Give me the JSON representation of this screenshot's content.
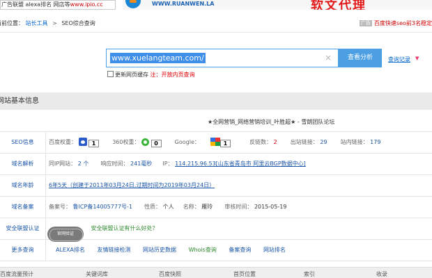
{
  "ads": {
    "left_part1": "广告联盟 alexa排名 网店等",
    "left_part2": "www.ipio.cc",
    "right_site": "WWW.RUANWEN.LA",
    "right_slogan": "软文代理"
  },
  "location": {
    "label": "当前位置：",
    "crumb1": "站长工具",
    "sep": ">",
    "crumb2": "SEO综合查询",
    "ad_tag": "广告",
    "ad_text": "百度快速seo前3名稳定"
  },
  "search": {
    "value": "www.xuelangteam.com/",
    "clear_icon": "×",
    "button": "查看分析",
    "history": "查询记录",
    "history_arrow": "▼",
    "cache_label": "更新网页缓存",
    "cache_note": "注：开放内页查询"
  },
  "section": {
    "title": "网站基本信息",
    "site_title": "★全网营销_网络营销培训_叶胜超★ - 雪朗团队论坛"
  },
  "rows": {
    "seo": {
      "label": "SEO信息",
      "baidu_label": "百度权重：",
      "baidu_val": "1",
      "q360_label": "360权重：",
      "q360_val": "0",
      "google_label": "Google：",
      "google_val": "1",
      "backlinks_label": "反链数：",
      "backlinks_val": "2",
      "outlinks_label": "出站链接：",
      "outlinks_val": "29",
      "inlinks_label": "站内链接：",
      "inlinks_val": "179"
    },
    "dns": {
      "label": "域名解析",
      "sameip_label": "同IP网站：",
      "sameip_val": "2 个",
      "resp_label": "响应时间：",
      "resp_val": "241毫秒",
      "ip_label": "IP：",
      "ip_val": "114.215.96.53[山东省青岛市 阿里云BGP数据中心]"
    },
    "age": {
      "label": "域名年龄",
      "val": "6年5天（创建于2011年03月24日,过期时间为2019年03月24日）"
    },
    "icp": {
      "label": "域名备案",
      "no_label": "备案号：",
      "no_val": "鲁ICP备14005777号-1",
      "nature_label": "性质：",
      "nature_val": "个人",
      "name_label": "名称：",
      "name_val": "雁玲",
      "date_label": "审核时间：",
      "date_val": "2015-05-19"
    },
    "cert": {
      "label": "安全联盟认证",
      "seal_text": "官网验证",
      "val": "安全联盟认证有什么好处？"
    },
    "more": {
      "label": "更多查询",
      "links": [
        "ALEXA排名",
        "友情链接检测",
        "网站历史数据",
        "Whois查询",
        "备案查询",
        "网站排名"
      ]
    }
  },
  "bottom_cols": [
    "百度流量预计",
    "关键词库",
    "百度快照",
    "首页位置",
    "索引",
    "收录"
  ]
}
